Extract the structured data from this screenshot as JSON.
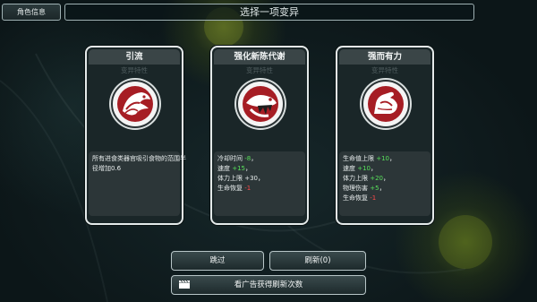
{
  "header": {
    "char_info": "角色信息",
    "title": "选择一项变异"
  },
  "cards": [
    {
      "name": "引流",
      "subtitle": "变异特性",
      "icon": "beast-mouth-icon",
      "desc": [
        [
          {
            "t": "所有进食类器官吸引食物的范围半",
            "c": ""
          }
        ],
        [
          {
            "t": "径增加0.6",
            "c": ""
          }
        ]
      ]
    },
    {
      "name": "强化新陈代谢",
      "subtitle": "变异特性",
      "icon": "fish-eating-icon",
      "desc": [
        [
          {
            "t": "冷却时间 ",
            "c": ""
          },
          {
            "t": "-8",
            "c": "pos"
          },
          {
            "t": "，",
            "c": ""
          }
        ],
        [
          {
            "t": "速度 ",
            "c": ""
          },
          {
            "t": "+15",
            "c": "pos"
          },
          {
            "t": "，",
            "c": ""
          }
        ],
        [
          {
            "t": "体力上限 +30，",
            "c": ""
          }
        ],
        [
          {
            "t": "生命恢复 ",
            "c": ""
          },
          {
            "t": "-1",
            "c": "neg"
          }
        ]
      ]
    },
    {
      "name": "强而有力",
      "subtitle": "变异特性",
      "icon": "flexed-arm-icon",
      "desc": [
        [
          {
            "t": "生命值上限 ",
            "c": ""
          },
          {
            "t": "+10",
            "c": "pos"
          },
          {
            "t": "，",
            "c": ""
          }
        ],
        [
          {
            "t": "速度 ",
            "c": ""
          },
          {
            "t": "+10",
            "c": "pos"
          },
          {
            "t": "，",
            "c": ""
          }
        ],
        [
          {
            "t": "体力上限 ",
            "c": ""
          },
          {
            "t": "+20",
            "c": "pos"
          },
          {
            "t": "，",
            "c": ""
          }
        ],
        [
          {
            "t": "物理伤害 ",
            "c": ""
          },
          {
            "t": "+5",
            "c": "pos"
          },
          {
            "t": "，",
            "c": ""
          }
        ],
        [
          {
            "t": "生命恢复 ",
            "c": ""
          },
          {
            "t": "-1",
            "c": "neg"
          }
        ]
      ]
    }
  ],
  "buttons": {
    "skip": "跳过",
    "refresh": "刷新(0)",
    "ad_refresh": "看广告获得刷新次数"
  },
  "colors": {
    "positive": "#58e05a",
    "negative": "#ff4a4a",
    "emblem_red": "#a61d24"
  }
}
